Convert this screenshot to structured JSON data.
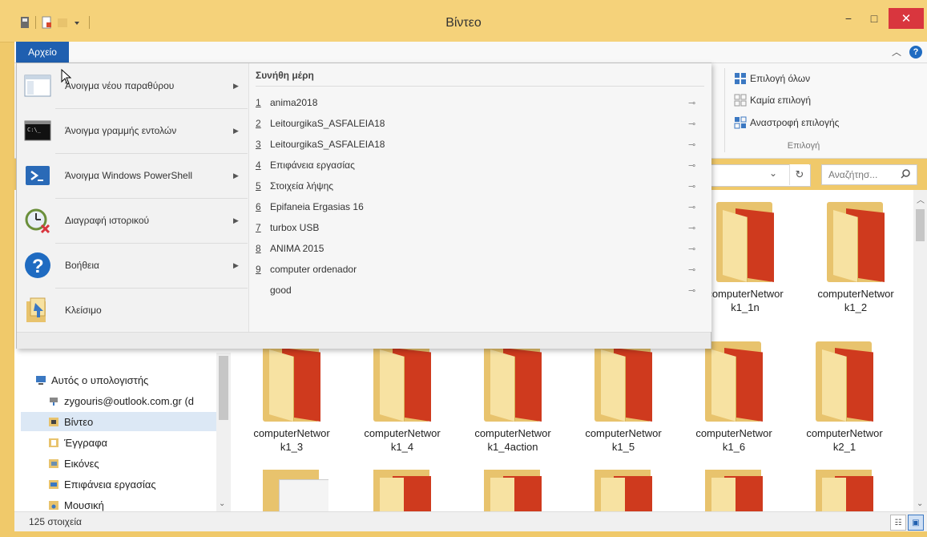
{
  "window": {
    "title": "Βίντεο",
    "min": "−",
    "max": "□",
    "close": "✕"
  },
  "ribbon": {
    "file_tab": "Αρχείο",
    "select_group": {
      "caption": "Επιλογή",
      "select_all": "Επιλογή όλων",
      "select_none": "Καμία επιλογή",
      "invert": "Αναστροφή επιλογής"
    }
  },
  "address": {
    "refresh": "↻",
    "dropdown": "⌄"
  },
  "search": {
    "placeholder": "Αναζήτησ...",
    "icon": "search-icon"
  },
  "file_menu": {
    "items": [
      {
        "label": "Άνοιγμα νέου παραθύρου",
        "icon": "new-window-icon",
        "has_arrow": true
      },
      {
        "label": "Άνοιγμα γραμμής εντολών",
        "icon": "command-prompt-icon",
        "has_arrow": true
      },
      {
        "label": "Άνοιγμα Windows PowerShell",
        "icon": "powershell-icon",
        "has_arrow": true
      },
      {
        "label": "Διαγραφή ιστορικού",
        "icon": "delete-history-icon",
        "has_arrow": true
      },
      {
        "label": "Βοήθεια",
        "icon": "help-icon",
        "has_arrow": true
      },
      {
        "label": "Κλείσιμο",
        "icon": "close-window-icon",
        "has_arrow": false
      }
    ],
    "frequent_heading": "Συνήθη μέρη",
    "frequent": [
      {
        "num": "1",
        "name": "anima2018"
      },
      {
        "num": "2",
        "name": "LeitourgikaS_ASFALEIA18"
      },
      {
        "num": "3",
        "name": "LeitourgikaS_ASFALEIA18"
      },
      {
        "num": "4",
        "name": "Επιφάνεια εργασίας"
      },
      {
        "num": "5",
        "name": "Στοιχεία λήψης"
      },
      {
        "num": "6",
        "name": "Epifaneia Ergasias 16"
      },
      {
        "num": "7",
        "name": "turbox USB"
      },
      {
        "num": "8",
        "name": "ANIMA 2015"
      },
      {
        "num": "9",
        "name": "computer ordenador"
      },
      {
        "num": "",
        "name": "good"
      }
    ],
    "pin_glyph": "⊸"
  },
  "nav": {
    "items": [
      {
        "label": "Αυτός ο υπολογιστής",
        "icon": "computer-icon",
        "selected": false
      },
      {
        "label": "zygouris@outlook.com.gr (d",
        "icon": "network-drive-icon",
        "selected": false
      },
      {
        "label": "Βίντεο",
        "icon": "videos-folder-icon",
        "selected": true
      },
      {
        "label": "Έγγραφα",
        "icon": "documents-folder-icon",
        "selected": false
      },
      {
        "label": "Εικόνες",
        "icon": "pictures-folder-icon",
        "selected": false
      },
      {
        "label": "Επιφάνεια εργασίας",
        "icon": "desktop-folder-icon",
        "selected": false
      },
      {
        "label": "Μουσική",
        "icon": "music-folder-icon",
        "selected": false
      }
    ]
  },
  "folders": {
    "row1": [
      {
        "line1": "computerNetwor",
        "line2": "k1_1n"
      },
      {
        "line1": "computerNetwor",
        "line2": "k1_2"
      }
    ],
    "row2": [
      {
        "line1": "computerNetwor",
        "line2": "k1_3"
      },
      {
        "line1": "computerNetwor",
        "line2": "k1_4"
      },
      {
        "line1": "computerNetwor",
        "line2": "k1_4action"
      },
      {
        "line1": "computerNetwor",
        "line2": "k1_5"
      },
      {
        "line1": "computerNetwor",
        "line2": "k1_6"
      },
      {
        "line1": "computerNetwor",
        "line2": "k2_1"
      }
    ]
  },
  "status": {
    "count": "125 στοιχεία"
  },
  "colors": {
    "title_bar": "#f5d27a",
    "file_tab": "#1f5fb0",
    "folder_red": "#cf3a1e",
    "folder_yellow": "#e8c36d",
    "close": "#d9363e"
  }
}
